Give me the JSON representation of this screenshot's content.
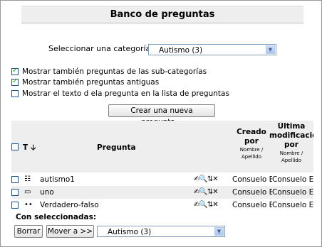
{
  "title": "Banco de preguntas",
  "category": {
    "label": "Seleccionar una categoría:",
    "selected": "Autismo (3)"
  },
  "options": [
    {
      "label": "Mostrar también preguntas de las sub-categorías",
      "checked": true
    },
    {
      "label": "Mostrar también preguntas antiguas",
      "checked": true
    },
    {
      "label": "Mostrar el texto d ela pregunta en la lista de preguntas",
      "checked": false
    }
  ],
  "create_button": "Crear una nueva pregunta...",
  "table": {
    "col_type": "T",
    "col_sort_icon": "down-arrow-icon",
    "col_question": "Pregunta",
    "col_created": [
      "Creado",
      "por"
    ],
    "col_created_sub": [
      "Nombre /",
      "Apellido"
    ],
    "col_modified": [
      "Última",
      "modificación",
      "por"
    ],
    "col_modified_sub": [
      "Nombre /",
      "Apellido"
    ],
    "rows": [
      {
        "icon": "multichoice-icon",
        "name": "autismo1",
        "created": "Consuelo E",
        "modified": "Consuelo E"
      },
      {
        "icon": "shortanswer-icon",
        "name": "uno",
        "created": "Consuelo E",
        "modified": "Consuelo E"
      },
      {
        "icon": "truefalse-icon",
        "name": "Verdadero-falso",
        "created": "Consuelo E",
        "modified": "Consuelo E"
      }
    ]
  },
  "with_selected_label": "Con seleccionadas:",
  "delete_button": "Borrar",
  "move_button": "Mover a >>",
  "move_target": "Autismo (3)"
}
